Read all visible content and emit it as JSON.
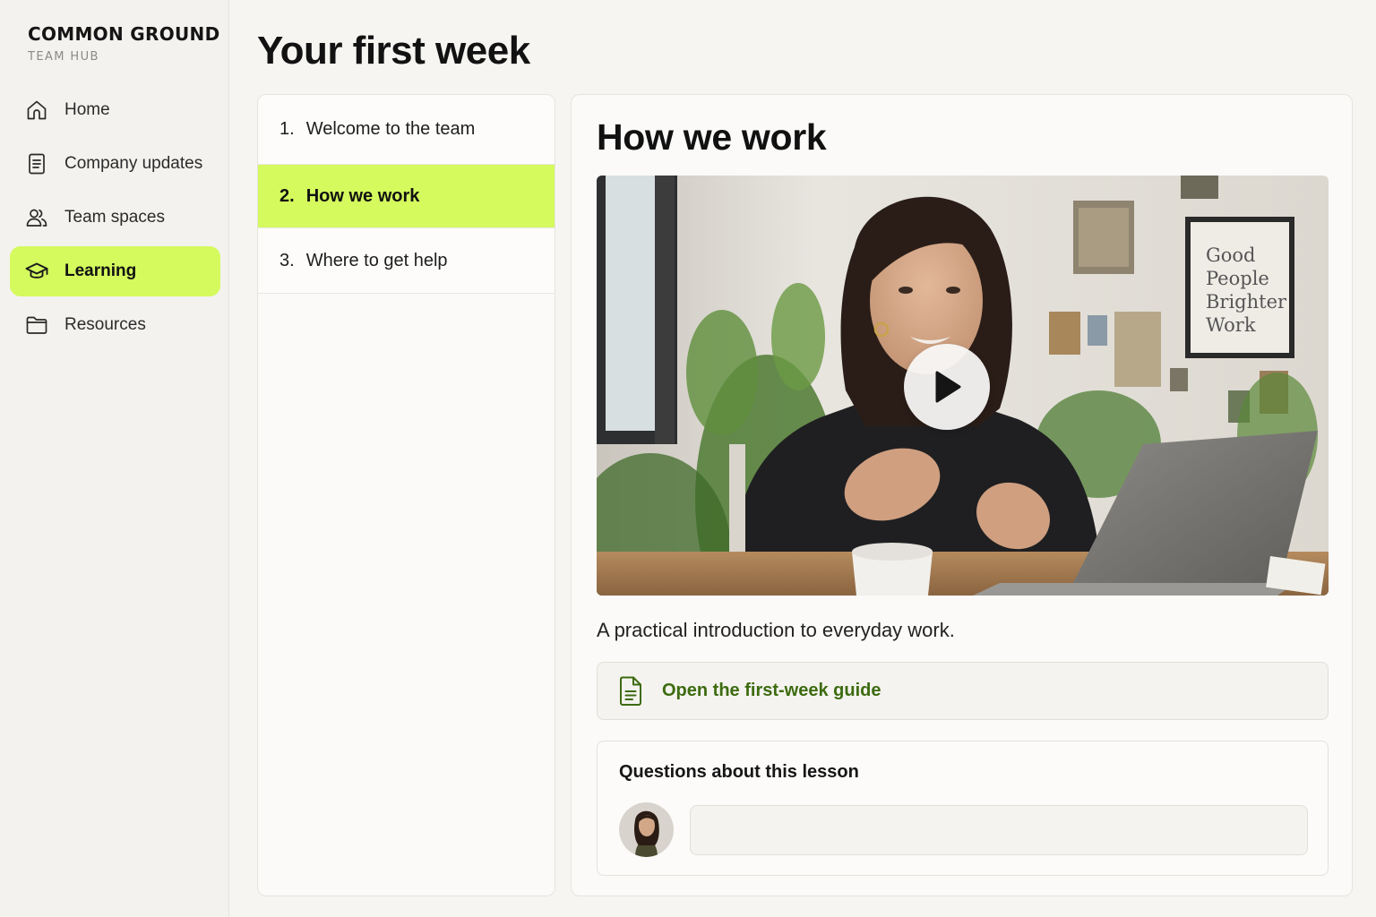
{
  "brand": {
    "name": "COMMON GROUND",
    "subtitle": "TEAM HUB"
  },
  "sidebar": {
    "items": [
      {
        "label": "Home",
        "icon": "home-icon",
        "active": false
      },
      {
        "label": "Company updates",
        "icon": "document-icon",
        "active": false
      },
      {
        "label": "Team spaces",
        "icon": "people-icon",
        "active": false
      },
      {
        "label": "Learning",
        "icon": "graduation-cap-icon",
        "active": true
      },
      {
        "label": "Resources",
        "icon": "folder-icon",
        "active": false
      }
    ]
  },
  "page": {
    "title": "Your first week"
  },
  "lessons": [
    {
      "number": "1.",
      "label": "Welcome to the team",
      "active": false
    },
    {
      "number": "2.",
      "label": "How we work",
      "active": true
    },
    {
      "number": "3.",
      "label": "Where to get help",
      "active": false
    }
  ],
  "lesson": {
    "title": "How we work",
    "video": {
      "icon": "play-icon",
      "poster_sign": "Good People Brighter Work"
    },
    "description": "A practical introduction to everyday work.",
    "guide": {
      "label": "Open the first-week guide",
      "icon": "document-icon"
    },
    "questions": {
      "title": "Questions about this lesson",
      "input_value": "",
      "input_placeholder": ""
    }
  },
  "colors": {
    "accent": "#d4fa5e",
    "link": "#3d6b10",
    "background": "#f6f5f1"
  }
}
